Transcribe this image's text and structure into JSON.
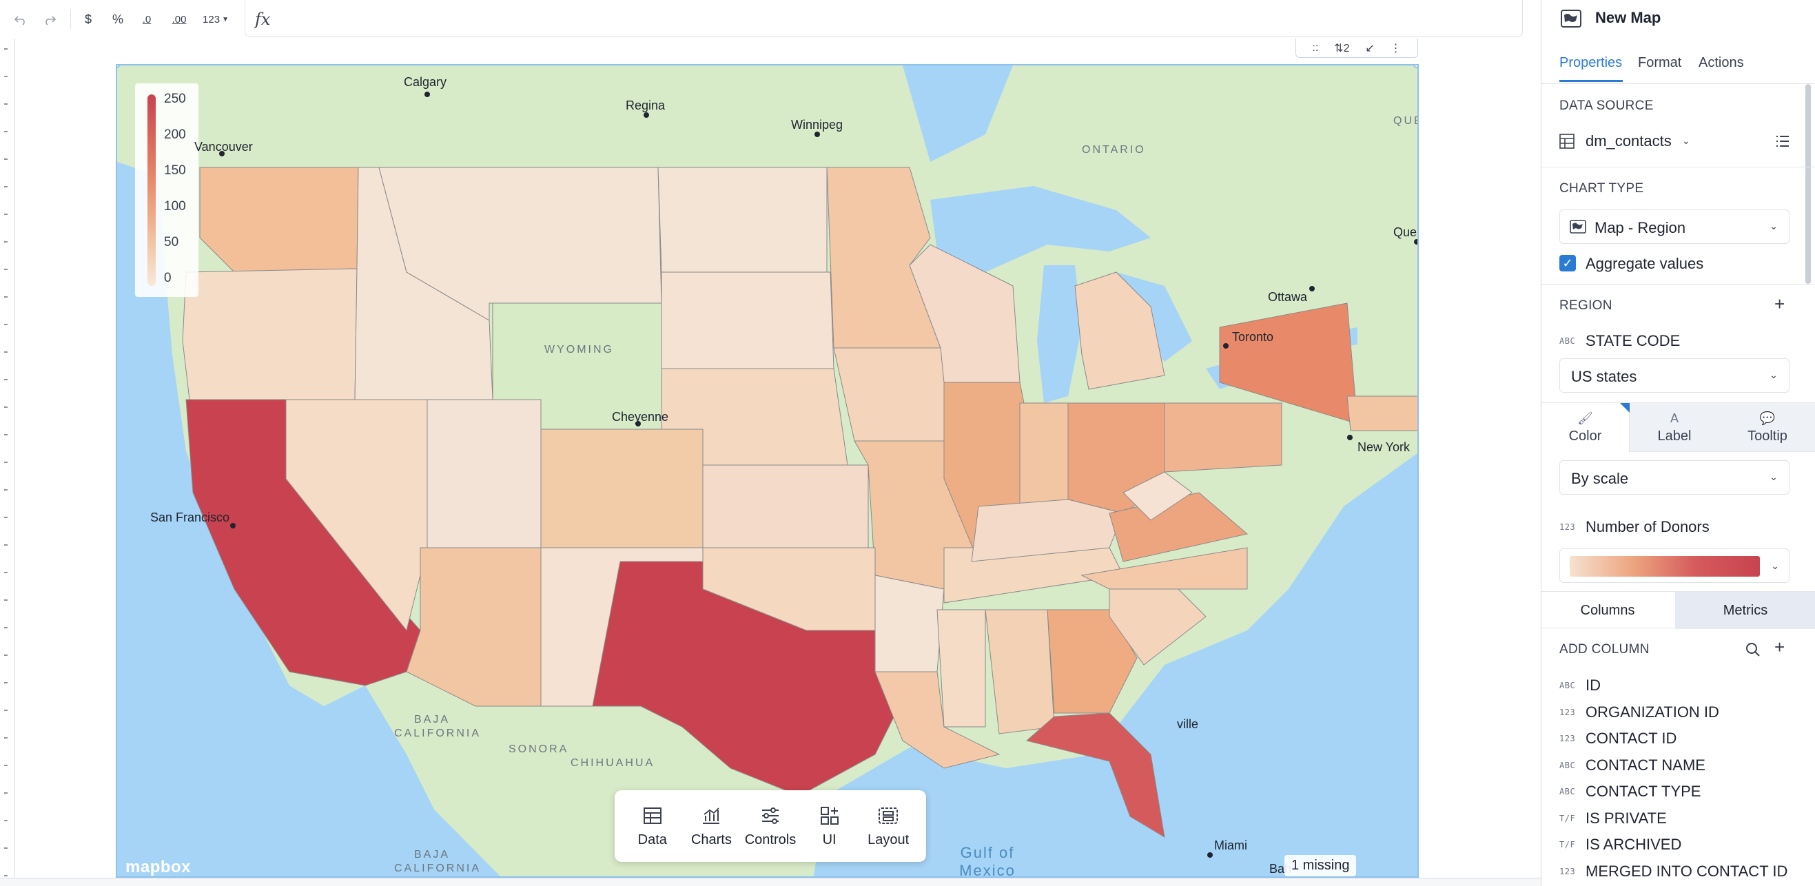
{
  "toolbar": {
    "undo_icon": "undo-icon",
    "redo_icon": "redo-icon",
    "currency_label": "$",
    "percent_label": "%",
    "decrease_decimal_label": ".0",
    "increase_decimal_label": ".00",
    "number_format_label": "123",
    "formula_label": "fx"
  },
  "widget_tools": {
    "t1": "::",
    "t2": "⇅2",
    "t3": "↙",
    "t4": "⋮"
  },
  "map": {
    "legend": {
      "labels": [
        "250",
        "200",
        "150",
        "100",
        "50",
        "0"
      ]
    },
    "cities": [
      {
        "name": "Calgary"
      },
      {
        "name": "Regina"
      },
      {
        "name": "Winnipeg"
      },
      {
        "name": "Vancouver"
      },
      {
        "name": "Cheyenne"
      },
      {
        "name": "San Francisco"
      },
      {
        "name": "Ottawa"
      },
      {
        "name": "Toronto"
      },
      {
        "name": "New York"
      },
      {
        "name": "Miami"
      },
      {
        "name": "Que"
      },
      {
        "name": "ville"
      },
      {
        "name": "Bah"
      }
    ],
    "regions": [
      {
        "name": "ONTARIO"
      },
      {
        "name": "QUÉBEC"
      },
      {
        "name": "WYOMING"
      },
      {
        "name": "BAJA CALIFORNIA"
      },
      {
        "name": "SONORA"
      },
      {
        "name": "CHIHUAHUA"
      },
      {
        "name": "BAJA CALIFORNIA SUR"
      }
    ],
    "water": "Gulf of Mexico",
    "attribution": "mapbox",
    "missing_badge": "1 missing",
    "colors": {
      "water": "#a6d4f6",
      "land": "#d8ebc8",
      "scale_low": "#f6e1d0",
      "scale_mid": "#eda57f",
      "scale_high": "#c8434f"
    }
  },
  "dock": {
    "items": [
      {
        "label": "Data",
        "icon": "table-icon"
      },
      {
        "label": "Charts",
        "icon": "chart-icon"
      },
      {
        "label": "Controls",
        "icon": "sliders-icon"
      },
      {
        "label": "UI",
        "icon": "ui-icon"
      },
      {
        "label": "Layout",
        "icon": "layout-icon"
      }
    ]
  },
  "panel": {
    "title": "New Map",
    "title_icon": "map-icon",
    "tabs": [
      "Properties",
      "Format",
      "Actions"
    ],
    "data_source": {
      "heading": "DATA SOURCE",
      "value": "dm_contacts"
    },
    "chart_type": {
      "heading": "CHART TYPE",
      "value": "Map - Region",
      "aggregate_label": "Aggregate values"
    },
    "region": {
      "heading": "REGION",
      "type_tag": "ABC",
      "field": "STATE CODE",
      "boundary": "US states"
    },
    "encoding_tabs": [
      "Color",
      "Label",
      "Tooltip"
    ],
    "color_mode": "By scale",
    "metric": {
      "type_tag": "123",
      "name": "Number of Donors"
    },
    "subtabs": [
      "Columns",
      "Metrics"
    ],
    "add_column": "ADD COLUMN",
    "columns": [
      {
        "type": "ABC",
        "name": "ID"
      },
      {
        "type": "123",
        "name": "ORGANIZATION ID"
      },
      {
        "type": "123",
        "name": "CONTACT ID"
      },
      {
        "type": "ABC",
        "name": "CONTACT NAME"
      },
      {
        "type": "ABC",
        "name": "CONTACT TYPE"
      },
      {
        "type": "T/F",
        "name": "IS PRIVATE"
      },
      {
        "type": "T/F",
        "name": "IS ARCHIVED"
      },
      {
        "type": "123",
        "name": "MERGED INTO CONTACT ID"
      }
    ]
  }
}
